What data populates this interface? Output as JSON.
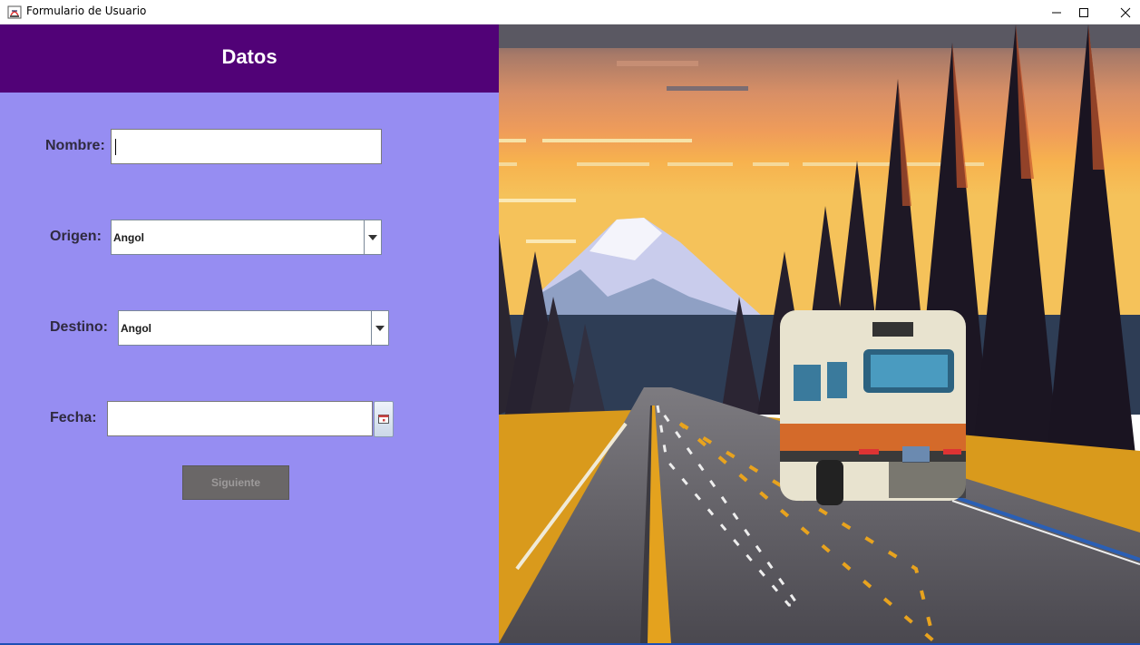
{
  "window": {
    "title": "Formulario de Usuario",
    "controls": {
      "minimize": "minimize-icon",
      "maximize": "maximize-icon",
      "close": "close-icon"
    }
  },
  "form": {
    "header": "Datos",
    "nombre": {
      "label": "Nombre:",
      "value": "",
      "placeholder": ""
    },
    "origen": {
      "label": "Origen:",
      "selected": "Angol"
    },
    "destino": {
      "label": "Destino:",
      "selected": "Angol"
    },
    "fecha": {
      "label": "Fecha:",
      "value": ""
    },
    "next_button": "Siguiente"
  },
  "image": {
    "description_icon": "pixel-art-road-bus-scene"
  },
  "colors": {
    "header_bg": "#510277",
    "panel_bg": "#968df2",
    "button_disabled": "#6a6767"
  }
}
